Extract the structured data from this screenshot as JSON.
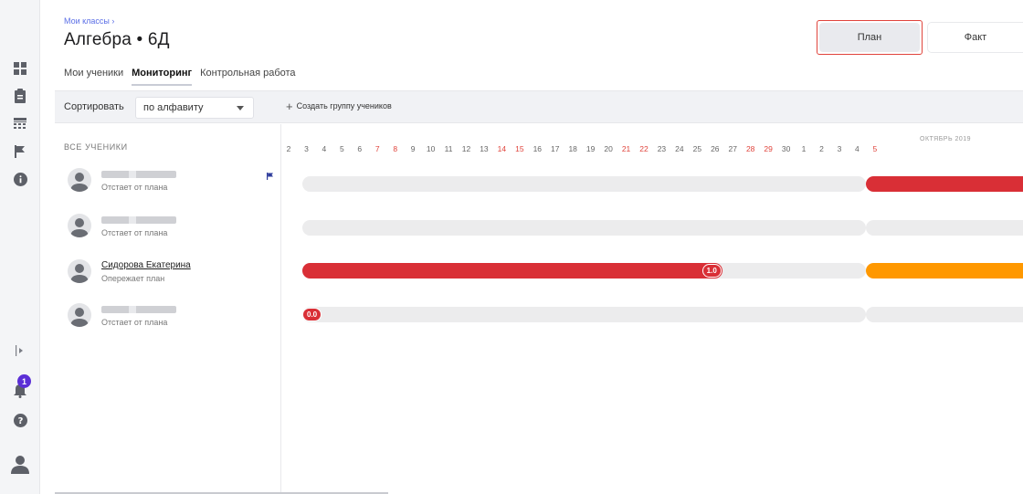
{
  "breadcrumb": "Мои классы ›",
  "title": "Алгебра • 6Д",
  "tabs": [
    {
      "label": "Мои ученики",
      "active": false
    },
    {
      "label": "Мониторинг",
      "active": true
    },
    {
      "label": "Контрольная работа",
      "active": false
    }
  ],
  "view_toggle": {
    "plan_label": "План",
    "fact_label": "Факт"
  },
  "toolbar": {
    "sort_label": "Сортировать",
    "sort_value": "по алфавиту",
    "create_group_label": "Создать группу учеников"
  },
  "students_header": "ВСЕ УЧЕНИКИ",
  "students": [
    {
      "name": "",
      "name_hidden": true,
      "status": "Отстает от плана",
      "flag": true
    },
    {
      "name": "",
      "name_hidden": true,
      "status": "Отстает от плана",
      "flag": false
    },
    {
      "name": "Сидорова Екатерина",
      "name_hidden": false,
      "status": "Опережает план",
      "flag": false
    },
    {
      "name": "",
      "name_hidden": true,
      "status": "Отстает от плана",
      "flag": false
    }
  ],
  "timeline": {
    "month_label": "ОКТЯБРЬ 2019",
    "days": [
      {
        "d": "2",
        "weekend": false
      },
      {
        "d": "3",
        "weekend": false
      },
      {
        "d": "4",
        "weekend": false
      },
      {
        "d": "5",
        "weekend": false
      },
      {
        "d": "6",
        "weekend": false
      },
      {
        "d": "7",
        "weekend": true
      },
      {
        "d": "8",
        "weekend": true
      },
      {
        "d": "9",
        "weekend": false
      },
      {
        "d": "10",
        "weekend": false
      },
      {
        "d": "11",
        "weekend": false
      },
      {
        "d": "12",
        "weekend": false
      },
      {
        "d": "13",
        "weekend": false
      },
      {
        "d": "14",
        "weekend": true
      },
      {
        "d": "15",
        "weekend": true
      },
      {
        "d": "16",
        "weekend": false
      },
      {
        "d": "17",
        "weekend": false
      },
      {
        "d": "18",
        "weekend": false
      },
      {
        "d": "19",
        "weekend": false
      },
      {
        "d": "20",
        "weekend": false
      },
      {
        "d": "21",
        "weekend": true
      },
      {
        "d": "22",
        "weekend": true
      },
      {
        "d": "23",
        "weekend": false
      },
      {
        "d": "24",
        "weekend": false
      },
      {
        "d": "25",
        "weekend": false
      },
      {
        "d": "26",
        "weekend": false
      },
      {
        "d": "27",
        "weekend": false
      },
      {
        "d": "28",
        "weekend": true
      },
      {
        "d": "29",
        "weekend": true
      },
      {
        "d": "30",
        "weekend": false
      },
      {
        "d": "1",
        "weekend": false
      },
      {
        "d": "2",
        "weekend": false
      },
      {
        "d": "3",
        "weekend": false
      },
      {
        "d": "4",
        "weekend": false
      },
      {
        "d": "5",
        "weekend": true
      }
    ],
    "rows": [
      {
        "progress_value": null,
        "second_segment": "red"
      },
      {
        "progress_value": null,
        "second_segment": "gray"
      },
      {
        "progress_value": "1.0",
        "progress_fill": "red",
        "second_segment": "orange"
      },
      {
        "progress_value": "0.0",
        "progress_fill": "none",
        "second_segment": "gray"
      }
    ]
  },
  "rail_icons": [
    "dashboard-icon",
    "clipboard-icon",
    "calendar-icon",
    "flag-icon",
    "info-icon",
    "expand-icon",
    "bell-icon",
    "help-icon",
    "user-avatar-icon"
  ],
  "notification_count": "1",
  "colors": {
    "accent": "#5a6ee6",
    "behind": "#d92f36",
    "ahead": "#ff9800",
    "track": "#ececed",
    "weekend": "#e0443c"
  }
}
